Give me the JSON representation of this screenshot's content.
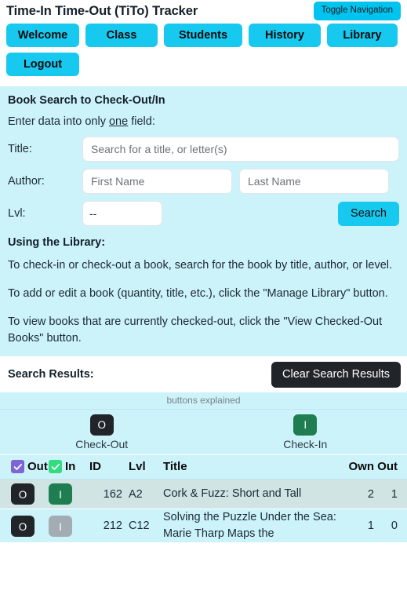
{
  "header": {
    "brand": "Time-In Time-Out (TiTo) Tracker",
    "toggle_nav": "Toggle Navigation"
  },
  "nav": {
    "row1": [
      {
        "label": "Welcome"
      },
      {
        "label": "Class"
      },
      {
        "label": "Students"
      },
      {
        "label": "History"
      },
      {
        "label": "Library"
      }
    ],
    "row2": [
      {
        "label": "Logout"
      }
    ]
  },
  "search_panel": {
    "heading": "Book Search to Check-Out/In",
    "hint_before": "Enter data into only ",
    "hint_underline": "one",
    "hint_after": " field:",
    "title_label": "Title:",
    "title_placeholder": "Search for a title, or letter(s)",
    "title_value": "",
    "author_label": "Author:",
    "first_placeholder": "First Name",
    "first_value": "",
    "last_placeholder": "Last Name",
    "last_value": "",
    "lvl_label": "Lvl:",
    "lvl_selected": "--",
    "search_button": "Search"
  },
  "instructions": {
    "heading": "Using the Library:",
    "paragraphs": [
      "To check-in or check-out a book, search for the book by title, author, or level.",
      "To add or edit a book (quantity, title, etc.), click the \"Manage Library\" button.",
      "To view books that are currently checked-out, click the \"View Checked-Out Books\" button."
    ]
  },
  "results": {
    "title": "Search Results:",
    "clear_button": "Clear Search Results",
    "explain_caption": "buttons explained",
    "explain": [
      {
        "glyph": "O",
        "label": "Check-Out",
        "style": "dark"
      },
      {
        "glyph": "I",
        "label": "Check-In",
        "style": "green"
      }
    ],
    "columns": {
      "out": "Out",
      "in": "In",
      "id": "ID",
      "lvl": "Lvl",
      "title": "Title",
      "own": "Own",
      "out_count": "Out"
    },
    "rows": [
      {
        "out_glyph": "O",
        "out_style": "dark",
        "in_glyph": "I",
        "in_style": "green",
        "id": "162",
        "lvl": "A2",
        "title": "Cork & Fuzz: Short and Tall",
        "own": "2",
        "out": "1"
      },
      {
        "out_glyph": "O",
        "out_style": "dark",
        "in_glyph": "I",
        "in_style": "grey",
        "id": "212",
        "lvl": "C12",
        "title": "Solving the Puzzle Under the Sea: Marie Tharp Maps the",
        "own": "1",
        "out": "0"
      }
    ]
  },
  "colors": {
    "nav_button": "#17c8ef",
    "panel_bg": "#ccf2fa",
    "dark_button": "#212529",
    "green_button": "#1e7e51",
    "grey_button": "#a3acb2",
    "checkbox_out": "#7e64d4",
    "checkbox_in": "#31dd7f",
    "row_stripe": "#cfe4e3"
  }
}
